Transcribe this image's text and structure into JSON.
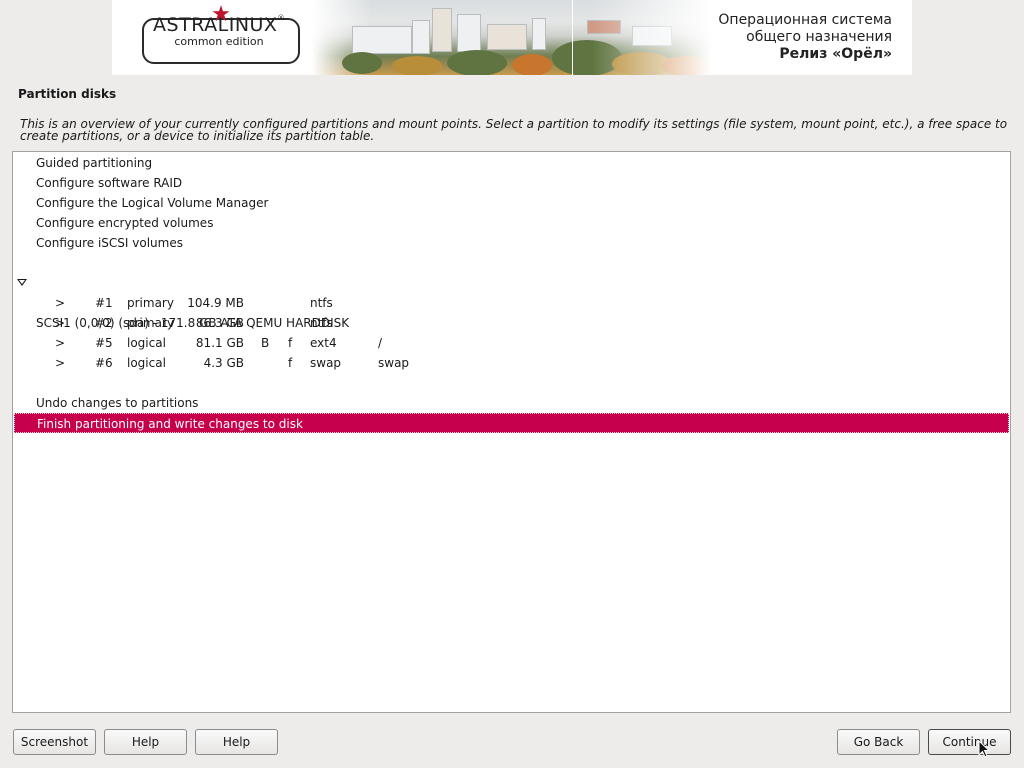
{
  "banner": {
    "logo_main": "ASTRALINUX",
    "logo_reg": "®",
    "logo_sub": "common edition",
    "os_line1": "Операционная система",
    "os_line2": "общего назначения",
    "os_release": "Релиз «Орёл»"
  },
  "page": {
    "title": "Partition disks",
    "intro": "This is an overview of your currently configured partitions and mount points. Select a partition to modify its settings (file system, mount point, etc.), a free space to create partitions, or a device to initialize its partition table."
  },
  "menu_items": [
    "Guided partitioning",
    "Configure software RAID",
    "Configure the Logical Volume Manager",
    "Configure encrypted volumes",
    "Configure iSCSI volumes"
  ],
  "disk": {
    "label": "SCSI1 (0,0,0) (sda) - 171.8 GB ATA QEMU HARDDISK",
    "partitions": [
      {
        "arrow": ">",
        "num": "#1",
        "type": "primary",
        "size": "104.9 MB",
        "boot": "",
        "format": "",
        "fs": "ntfs",
        "mount": ""
      },
      {
        "arrow": ">",
        "num": "#2",
        "type": "primary",
        "size": "86.3 GB",
        "boot": "",
        "format": "",
        "fs": "ntfs",
        "mount": ""
      },
      {
        "arrow": ">",
        "num": "#5",
        "type": "logical",
        "size": "81.1 GB",
        "boot": "B",
        "format": "f",
        "fs": "ext4",
        "mount": "/"
      },
      {
        "arrow": ">",
        "num": "#6",
        "type": "logical",
        "size": "4.3 GB",
        "boot": "",
        "format": "f",
        "fs": "swap",
        "mount": "swap"
      }
    ]
  },
  "actions": {
    "undo": "Undo changes to partitions",
    "finish": "Finish partitioning and write changes to disk"
  },
  "buttons": {
    "screenshot": "Screenshot",
    "help1": "Help",
    "help2": "Help",
    "go_back": "Go Back",
    "continue": "Continue"
  },
  "colors": {
    "selection": "#c6004b",
    "star": "#c0142c"
  }
}
